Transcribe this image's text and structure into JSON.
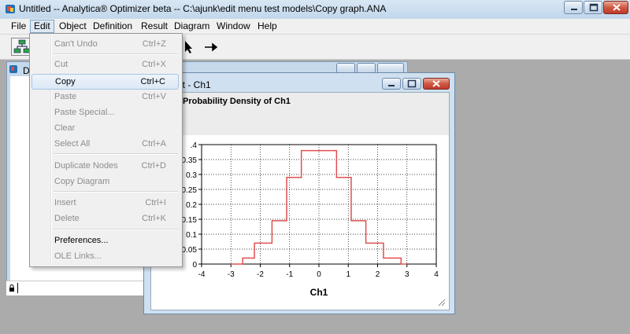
{
  "window": {
    "title": "Untitled -- Analytica® Optimizer beta -- C:\\ajunk\\edit menu test models\\Copy graph.ANA"
  },
  "menubar": [
    "File",
    "Edit",
    "Object",
    "Definition",
    "Result",
    "Diagram",
    "Window",
    "Help"
  ],
  "active_menu": "Edit",
  "edit_menu": {
    "items": [
      {
        "label": "Can't Undo",
        "shortcut": "Ctrl+Z",
        "enabled": false
      },
      {
        "label": "Cut",
        "shortcut": "Ctrl+X",
        "enabled": false
      },
      {
        "label": "Copy",
        "shortcut": "Ctrl+C",
        "enabled": true,
        "highlighted": true
      },
      {
        "label": "Paste",
        "shortcut": "Ctrl+V",
        "enabled": false
      },
      {
        "label": "Paste Special...",
        "shortcut": "",
        "enabled": false
      },
      {
        "label": "Clear",
        "shortcut": "",
        "enabled": false
      },
      {
        "label": "Select All",
        "shortcut": "Ctrl+A",
        "enabled": false
      },
      {
        "label": "Duplicate Nodes",
        "shortcut": "Ctrl+D",
        "enabled": false
      },
      {
        "label": "Copy Diagram",
        "shortcut": "",
        "enabled": false
      },
      {
        "label": "Insert",
        "shortcut": "Ctrl+I",
        "enabled": false
      },
      {
        "label": "Delete",
        "shortcut": "Ctrl+K",
        "enabled": false
      },
      {
        "label": "Preferences...",
        "shortcut": "",
        "enabled": true
      },
      {
        "label": "OLE Links...",
        "shortcut": "",
        "enabled": false
      }
    ]
  },
  "diagram_window": {
    "title_fragment": "D"
  },
  "result_window": {
    "title": "lt - Ch1",
    "heading": "Probability Density of Ch1"
  },
  "chart_data": {
    "type": "line",
    "step": true,
    "xlabel": "Ch1",
    "ylabel": "",
    "xlim": [
      -4,
      4
    ],
    "ylim": [
      0,
      0.4
    ],
    "x_ticks": [
      "-4",
      "-3",
      "-2",
      "-1",
      "0",
      "1",
      "2",
      "3",
      "4"
    ],
    "y_ticks": [
      ".4",
      "0.35",
      "0.3",
      "0.25",
      "0.2",
      "0.15",
      "0.1",
      "0.05",
      "0"
    ],
    "grid": true,
    "color": "#e05050",
    "bins": [
      {
        "from": -3.0,
        "to": -2.6,
        "y": 0.0
      },
      {
        "from": -2.6,
        "to": -2.2,
        "y": 0.02
      },
      {
        "from": -2.2,
        "to": -1.6,
        "y": 0.07
      },
      {
        "from": -1.6,
        "to": -1.1,
        "y": 0.145
      },
      {
        "from": -1.1,
        "to": -0.6,
        "y": 0.29
      },
      {
        "from": -0.6,
        "to": 0.6,
        "y": 0.38
      },
      {
        "from": 0.6,
        "to": 1.1,
        "y": 0.29
      },
      {
        "from": 1.1,
        "to": 1.6,
        "y": 0.145
      },
      {
        "from": 1.6,
        "to": 2.2,
        "y": 0.07
      },
      {
        "from": 2.2,
        "to": 2.8,
        "y": 0.02
      },
      {
        "from": 2.8,
        "to": 3.0,
        "y": 0.0
      }
    ]
  }
}
